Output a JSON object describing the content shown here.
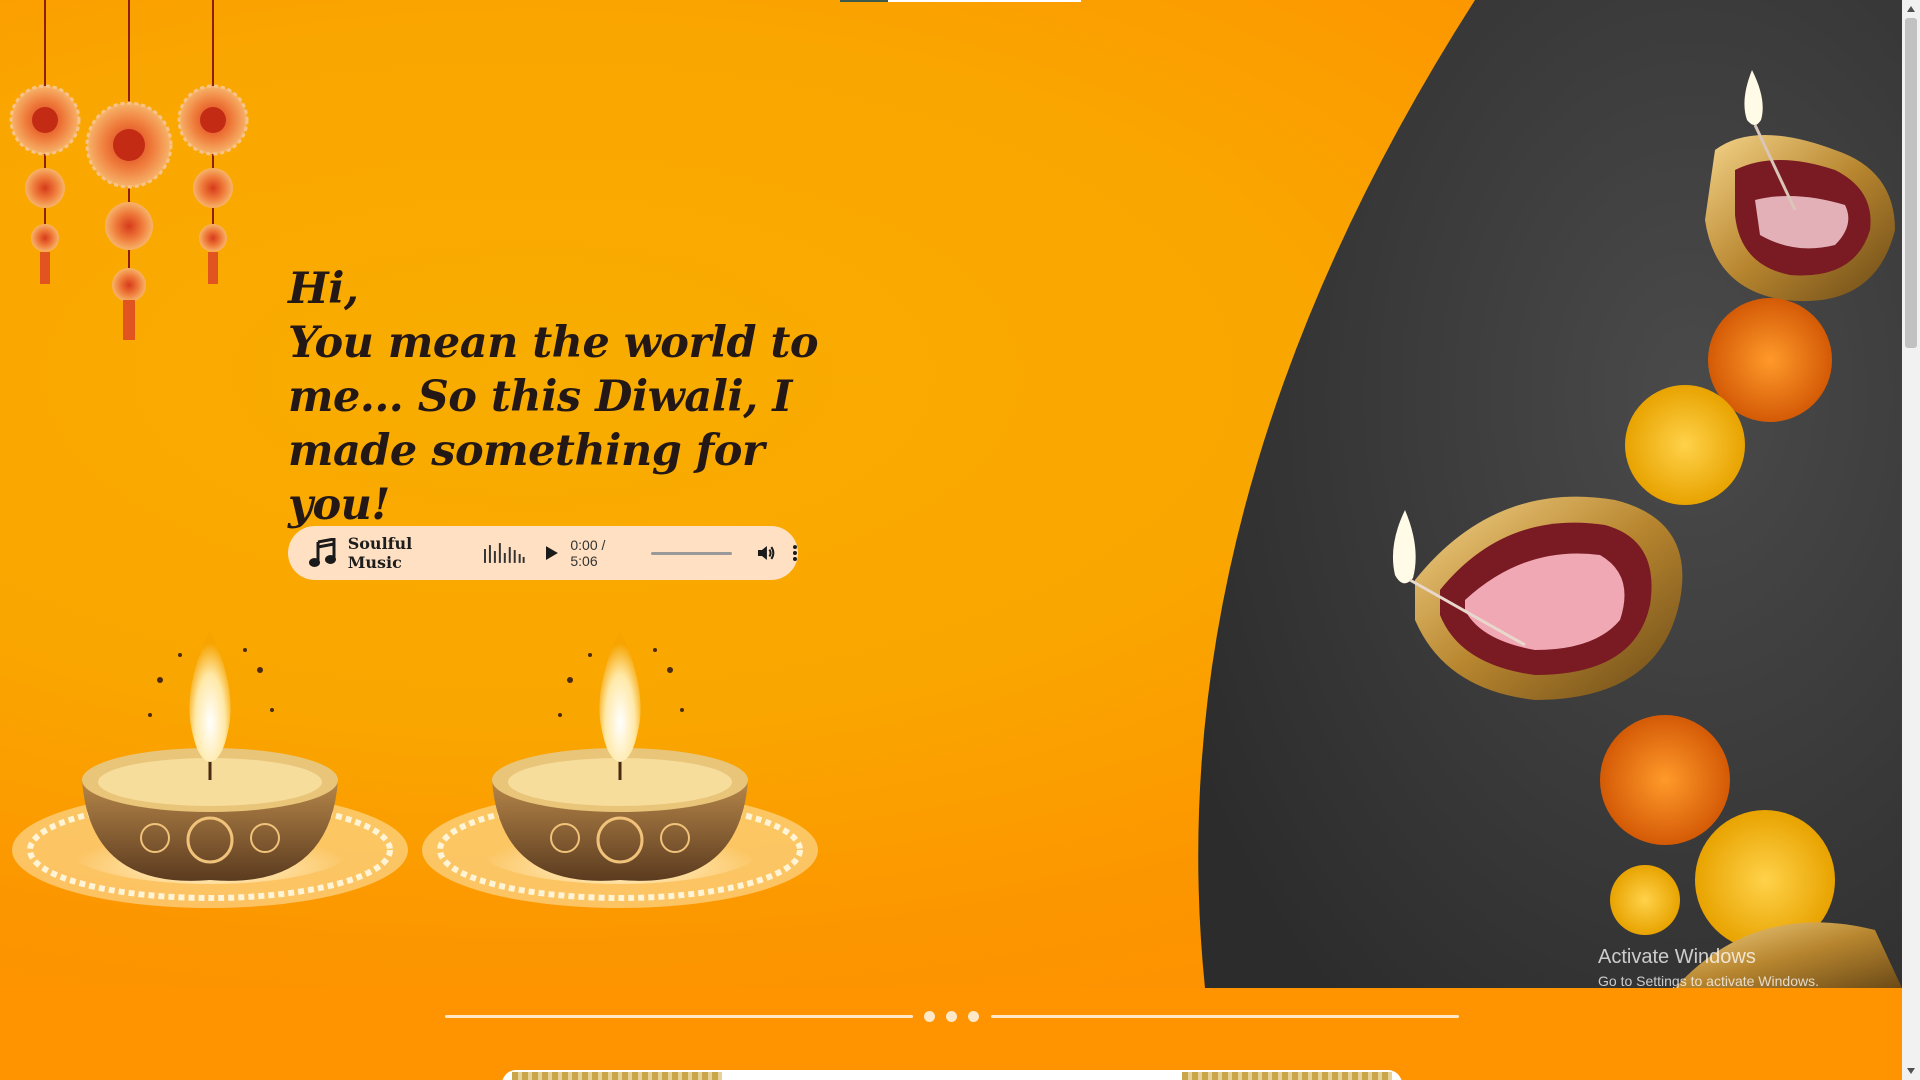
{
  "greeting": {
    "line1": "Hi,",
    "line2": "You mean the world to",
    "line3": "me... So this Diwali, I",
    "line4": "made something for you!"
  },
  "player": {
    "title": "Soulful Music",
    "time": "0:00 / 5:06",
    "progress": 0,
    "icons": [
      "music-note-icon",
      "equalizer-icon",
      "play-icon",
      "volume-icon",
      "more-options-icon"
    ]
  },
  "watermark": {
    "line1": "Activate Windows",
    "line2": "Go to Settings to activate Windows."
  },
  "colors": {
    "background": "#ff9300",
    "player_bg": "#ffe0c2",
    "text": "#231815",
    "photo_bg": "#3a3a3a"
  }
}
